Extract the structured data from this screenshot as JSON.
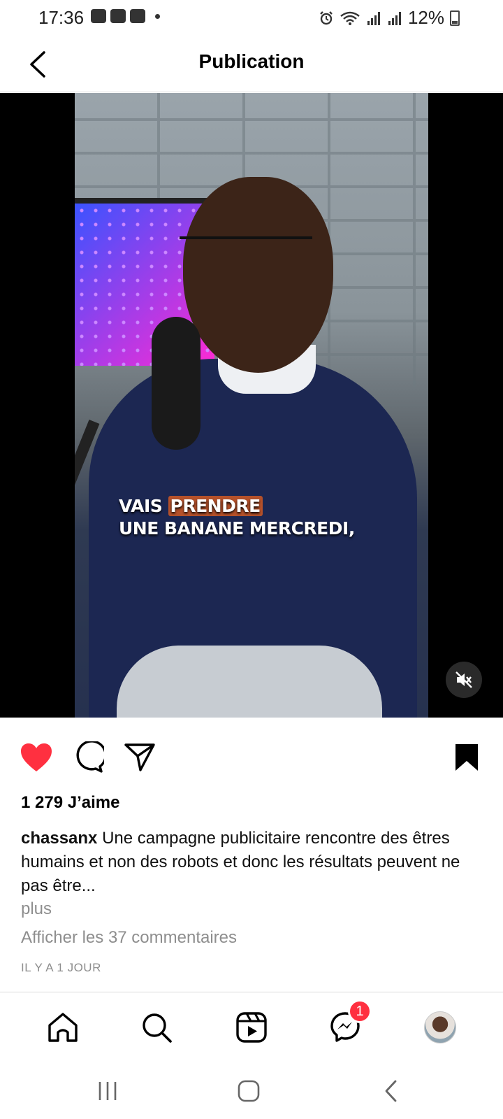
{
  "status_bar": {
    "time": "17:36",
    "battery": "12%",
    "icons": [
      "gallery-icon",
      "youtube-icon",
      "youtube-icon",
      "alarm-icon",
      "wifi-icon",
      "signal-icon",
      "signal-icon",
      "battery-charging-icon"
    ]
  },
  "header": {
    "title": "Publication",
    "back_icon": "chevron-left-icon"
  },
  "media": {
    "subtitle_line1_a": "VAIS ",
    "subtitle_line1_highlight": "PRENDRE",
    "subtitle_line2": "UNE BANANE MERCREDI,",
    "mute_icon": "volume-muted-icon",
    "highlight_color": "#b5512a"
  },
  "actions": {
    "liked": true,
    "like_color": "#ff3040",
    "icons": [
      "heart-icon",
      "comment-icon",
      "share-icon",
      "bookmark-icon"
    ]
  },
  "post": {
    "likes": "1 279 J’aime",
    "username": "chassanx",
    "caption": " Une campagne publicitaire rencontre des êtres humains et non des robots et donc les résultats peuvent ne pas être...",
    "more": "plus",
    "comments": "Afficher les 37 commentaires",
    "timestamp": "IL Y A 1 JOUR"
  },
  "bottom_nav": {
    "items": [
      "home-icon",
      "search-icon",
      "reels-icon",
      "messenger-icon",
      "profile-avatar"
    ],
    "messenger_badge": "1"
  },
  "system_nav": {
    "items": [
      "recents-icon",
      "home-button-icon",
      "back-icon"
    ]
  }
}
